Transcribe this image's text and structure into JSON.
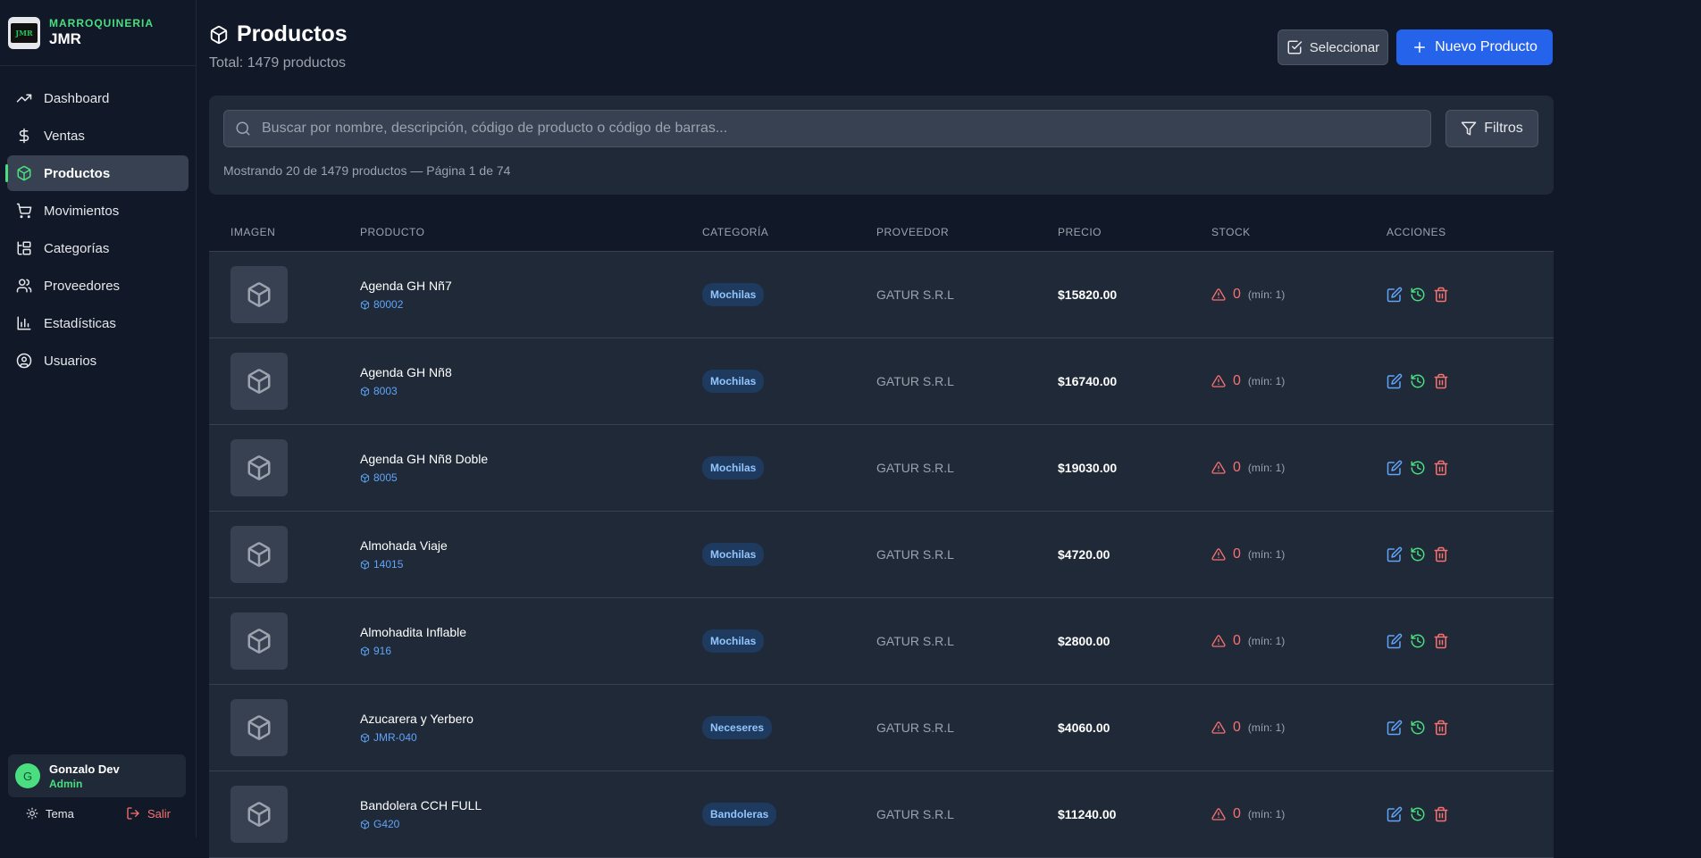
{
  "brand": {
    "line1": "MARROQUINERIA",
    "line2": "JMR",
    "logo_text": "JMR"
  },
  "nav": [
    {
      "label": "Dashboard",
      "icon": "trending-up-icon",
      "active": false
    },
    {
      "label": "Ventas",
      "icon": "dollar-icon",
      "active": false
    },
    {
      "label": "Productos",
      "icon": "box-icon",
      "active": true
    },
    {
      "label": "Movimientos",
      "icon": "cart-icon",
      "active": false
    },
    {
      "label": "Categorías",
      "icon": "folder-tree-icon",
      "active": false
    },
    {
      "label": "Proveedores",
      "icon": "users-icon",
      "active": false
    },
    {
      "label": "Estadísticas",
      "icon": "bar-chart-icon",
      "active": false
    },
    {
      "label": "Usuarios",
      "icon": "user-circle-icon",
      "active": false
    }
  ],
  "user": {
    "initial": "G",
    "name": "Gonzalo Dev",
    "role": "Admin"
  },
  "bottom": {
    "theme_label": "Tema",
    "logout_label": "Salir"
  },
  "header": {
    "title": "Productos",
    "subtitle": "Total: 1479 productos",
    "select_label": "Seleccionar",
    "new_label": "Nuevo Producto"
  },
  "search": {
    "placeholder": "Buscar por nombre, descripción, código de producto o código de barras...",
    "filters_label": "Filtros",
    "showing": "Mostrando 20 de 1479 productos — Página 1 de 74"
  },
  "table": {
    "headers": {
      "image": "IMAGEN",
      "product": "PRODUCTO",
      "category": "CATEGORÍA",
      "provider": "PROVEEDOR",
      "price": "PRECIO",
      "stock": "STOCK",
      "actions": "ACCIONES"
    },
    "rows": [
      {
        "name": "Agenda GH Nñ7",
        "code": "80002",
        "category": "Mochilas",
        "provider": "GATUR S.R.L",
        "price": "$15820.00",
        "stock": "0",
        "min": "(mín: 1)"
      },
      {
        "name": "Agenda GH Nñ8",
        "code": "8003",
        "category": "Mochilas",
        "provider": "GATUR S.R.L",
        "price": "$16740.00",
        "stock": "0",
        "min": "(mín: 1)"
      },
      {
        "name": "Agenda GH Nñ8 Doble",
        "code": "8005",
        "category": "Mochilas",
        "provider": "GATUR S.R.L",
        "price": "$19030.00",
        "stock": "0",
        "min": "(mín: 1)"
      },
      {
        "name": "Almohada Viaje",
        "code": "14015",
        "category": "Mochilas",
        "provider": "GATUR S.R.L",
        "price": "$4720.00",
        "stock": "0",
        "min": "(mín: 1)"
      },
      {
        "name": "Almohadita Inflable",
        "code": "916",
        "category": "Mochilas",
        "provider": "GATUR S.R.L",
        "price": "$2800.00",
        "stock": "0",
        "min": "(mín: 1)"
      },
      {
        "name": "Azucarera y Yerbero",
        "code": "JMR-040",
        "category": "Neceseres",
        "provider": "GATUR S.R.L",
        "price": "$4060.00",
        "stock": "0",
        "min": "(mín: 1)"
      },
      {
        "name": "Bandolera CCH FULL",
        "code": "G420",
        "category": "Bandoleras",
        "provider": "GATUR S.R.L",
        "price": "$11240.00",
        "stock": "0",
        "min": "(mín: 1)"
      }
    ]
  },
  "colors": {
    "accent": "#2563eb",
    "active_green": "#4ade80",
    "danger": "#f87171",
    "history_green": "#4ade80",
    "edit_blue": "#60a5fa"
  }
}
